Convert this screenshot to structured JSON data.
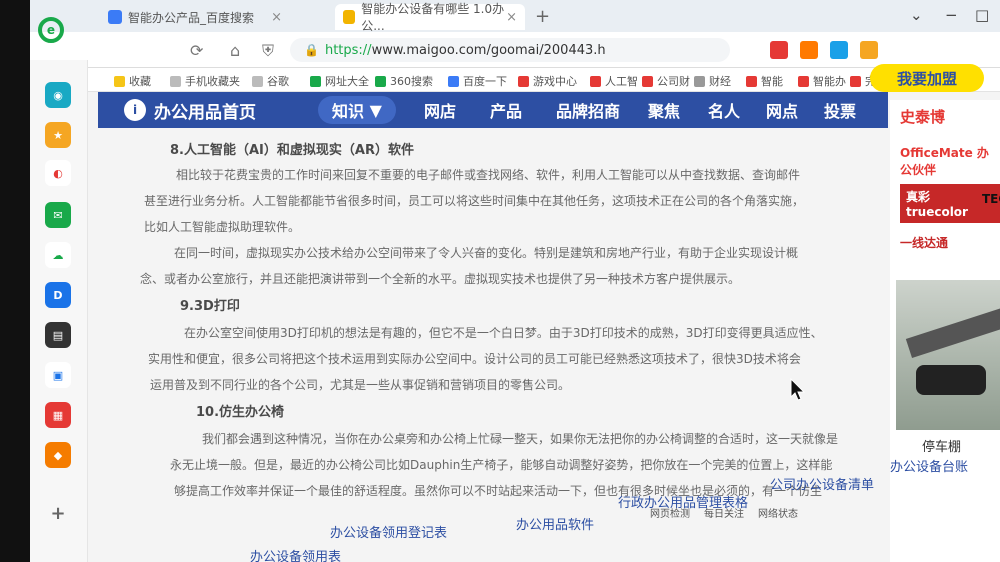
{
  "browser": {
    "tabs": [
      {
        "label": "智能办公产品_百度搜索",
        "close": "×"
      },
      {
        "label": "智能办公设备有哪些 1.0办公...",
        "close": "×"
      }
    ],
    "new_tab": "+",
    "window_controls": [
      "⌄",
      "−",
      "□"
    ],
    "url_scheme": "https://",
    "url_rest": "www.maigoo.com/goomai/200443.h",
    "bookmarks": [
      "收藏",
      "手机收藏夹",
      "谷歌",
      "网址大全",
      "360搜索",
      "百度一下",
      "游戏中心",
      "人工智",
      "公司财",
      "财经",
      "智能",
      "智能办",
      "完美终"
    ]
  },
  "site": {
    "brand": "办公用品首页",
    "nav": [
      "知识",
      "网店",
      "产品",
      "品牌招商",
      "聚焦",
      "名人",
      "网点",
      "投票"
    ],
    "join_button": "我要加盟"
  },
  "article": {
    "h8": "8.人工智能（AI）和虚拟现实（AR）软件",
    "p8_1": "相比较于花费宝贵的工作时间来回复不重要的电子邮件或查找网络、软件，利用人工智能可以从中查找数据、查询邮件",
    "p8_2": "甚至进行业务分析。人工智能都能节省很多时间，员工可以将这些时间集中在其他任务，这项技术正在公司的各个角落实施，",
    "p8_3": "比如人工智能虚拟助理软件。",
    "p8_4": "在同一时间，虚拟现实办公技术给办公空间带来了令人兴奋的变化。特别是建筑和房地产行业，有助于企业实现设计概",
    "p8_5": "念、或者办公室旅行，并且还能把演讲带到一个全新的水平。虚拟现实技术也提供了另一种技术方客户提供展示。",
    "h9": "9.3D打印",
    "p9_1": "在办公室空间使用3D打印机的想法是有趣的，但它不是一个白日梦。由于3D打印技术的成熟，3D打印变得更具适应性、",
    "p9_2": "实用性和便宜，很多公司将把这个技术运用到实际办公空间中。设计公司的员工可能已经熟悉这项技术了，很快3D技术将会",
    "p9_3": "运用普及到不同行业的各个公司，尤其是一些从事促销和营销项目的零售公司。",
    "h10": "10.仿生办公椅",
    "p10_1": "我们都会遇到这种情况，当你在办公桌旁和办公椅上忙碌一整天，如果你无法把你的办公椅调整的合适时，这一天就像是",
    "p10_2": "永无止境一般。但是，最近的办公椅公司比如Dauphin生产椅子，能够自动调整好姿势，把你放在一个完美的位置上，这样能",
    "p10_3": "够提高工作效率并保证一个最佳的舒适程度。虽然你可以不时站起来活动一下，但也有很多时候坐也是必须的，有一个仿生"
  },
  "right": {
    "logos": [
      "史泰博",
      "OfficeMate 办公伙伴",
      "真彩 truecolor",
      "TEC",
      "一线达通"
    ],
    "photo_caption": "停车棚",
    "link": "办公设备台账"
  },
  "bottom_links": [
    "办公设备领用登记表",
    "办公用品软件",
    "行政办公用品管理表格",
    "公司办公设备清单",
    "办公设备领用表"
  ],
  "status": [
    "网页检测",
    "每日关注",
    "网络状态"
  ]
}
